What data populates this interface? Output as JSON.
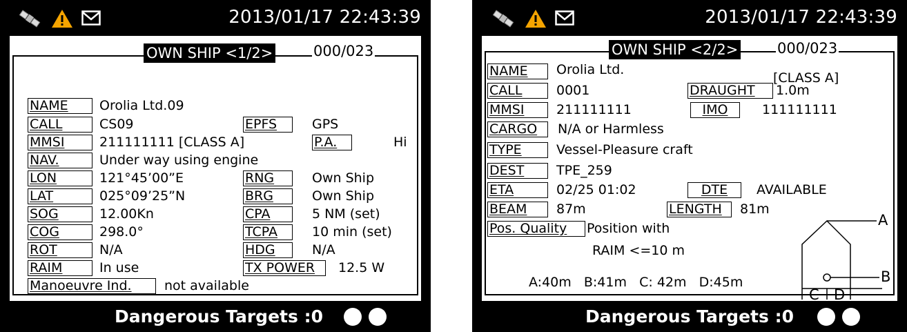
{
  "screen1": {
    "datetime": "2013/01/17 22:43:39",
    "title": "OWN SHIP <1/2>",
    "count": "000/023",
    "fields": {
      "name_label": "NAME",
      "name_value": "Orolia Ltd.09",
      "call_label": "CALL",
      "call_value": "CS09",
      "epfs_label": "EPFS",
      "epfs_value": "GPS",
      "mmsi_label": "MMSI",
      "mmsi_value": "211111111 [CLASS A]",
      "pa_label": "P.A.",
      "pa_value": "Hi",
      "nav_label": "NAV.",
      "nav_value": "Under way using engine",
      "lon_label": "LON",
      "lon_value": "121°45’00”E",
      "rng_label": "RNG",
      "rng_value": "Own Ship",
      "lat_label": "LAT",
      "lat_value": "025°09’25”N",
      "brg_label": "BRG",
      "brg_value": "Own Ship",
      "sog_label": "SOG",
      "sog_value": "12.00Kn",
      "cpa_label": "CPA",
      "cpa_value": "5 NM (set)",
      "cog_label": "COG",
      "cog_value": "298.0°",
      "tcpa_label": "TCPA",
      "tcpa_value": "10 min (set)",
      "rot_label": "ROT",
      "rot_value": "N/A",
      "hdg_label": "HDG",
      "hdg_value": "N/A",
      "raim_label": "RAIM",
      "raim_value": "In use",
      "txpower_label": "TX POWER",
      "txpower_value": "12.5 W",
      "manoeuvre_label": "Manoeuvre Ind.",
      "manoeuvre_value": "not available"
    },
    "footer": "Dangerous Targets :0"
  },
  "screen2": {
    "datetime": "2013/01/17 22:43:39",
    "title": "OWN SHIP <2/2>",
    "count": "000/023",
    "fields": {
      "name_label": "NAME",
      "name_value": "Orolia Ltd.",
      "class_value": "[CLASS A]",
      "call_label": "CALL",
      "call_value": "0001",
      "draught_label": "DRAUGHT",
      "draught_value": "1.0m",
      "mmsi_label": "MMSI",
      "mmsi_value": "211111111",
      "imo_label": "IMO",
      "imo_value": "111111111",
      "cargo_label": "CARGO",
      "cargo_value": "N/A or Harmless",
      "type_label": "TYPE",
      "type_value": "Vessel-Pleasure craft",
      "dest_label": "DEST",
      "dest_value": "TPE_259",
      "eta_label": "ETA",
      "eta_value": "02/25 01:02",
      "dte_label": "DTE",
      "dte_value": "AVAILABLE",
      "beam_label": "BEAM",
      "beam_value": "87m",
      "length_label": "LENGTH",
      "length_value": "81m",
      "posq_label": "Pos. Quality",
      "posq_value1": "Position with",
      "posq_value2": "RAIM <=10 m",
      "dims": "A:40m   B:41m   C: 42m   D:45m",
      "diagram_a": "A",
      "diagram_b": "B",
      "diagram_c": "C",
      "diagram_d": "D"
    },
    "footer": "Dangerous Targets :0"
  },
  "colors": {
    "background": "#000000",
    "panel": "#ffffff",
    "warning": "#f5a400"
  },
  "icons": [
    "satellite-icon",
    "warning-icon",
    "mail-icon",
    "status-dot"
  ]
}
